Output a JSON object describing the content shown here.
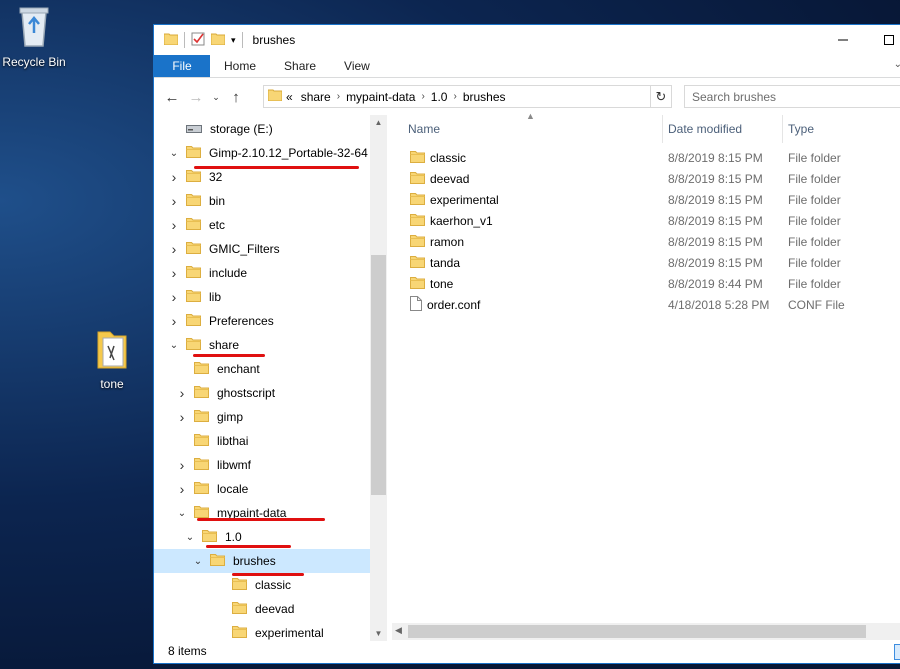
{
  "desktop": {
    "icons": [
      {
        "label": "Recycle Bin",
        "icon": "recycle-bin-icon"
      },
      {
        "label": "tone",
        "icon": "folder-icon"
      }
    ]
  },
  "window": {
    "title": "brushes",
    "ribbon_tabs": [
      "File",
      "Home",
      "Share",
      "View"
    ],
    "breadcrumb": [
      "share",
      "mypaint-data",
      "1.0",
      "brushes"
    ],
    "breadcrumb_overflow": "«",
    "search_placeholder": "Search brushes",
    "status": "8 items"
  },
  "nav_tree": [
    {
      "label": "storage (E:)",
      "level": 0,
      "toggle": "",
      "icon": "drive-icon"
    },
    {
      "label": "Gimp-2.10.12_Portable-32-64",
      "level": 0,
      "toggle": "expanded",
      "icon": "folder-icon"
    },
    {
      "label": "32",
      "level": 1,
      "toggle": "collapsed",
      "icon": "folder-icon"
    },
    {
      "label": "bin",
      "level": 1,
      "toggle": "collapsed",
      "icon": "folder-icon"
    },
    {
      "label": "etc",
      "level": 1,
      "toggle": "collapsed",
      "icon": "folder-icon"
    },
    {
      "label": "GMIC_Filters",
      "level": 1,
      "toggle": "collapsed",
      "icon": "folder-icon"
    },
    {
      "label": "include",
      "level": 1,
      "toggle": "collapsed",
      "icon": "folder-icon"
    },
    {
      "label": "lib",
      "level": 1,
      "toggle": "collapsed",
      "icon": "folder-icon"
    },
    {
      "label": "Preferences",
      "level": 1,
      "toggle": "collapsed",
      "icon": "folder-icon"
    },
    {
      "label": "share",
      "level": 1,
      "toggle": "expanded",
      "icon": "folder-icon"
    },
    {
      "label": "enchant",
      "level": 2,
      "toggle": "",
      "icon": "folder-icon"
    },
    {
      "label": "ghostscript",
      "level": 2,
      "toggle": "collapsed",
      "icon": "folder-icon"
    },
    {
      "label": "gimp",
      "level": 2,
      "toggle": "collapsed",
      "icon": "folder-icon"
    },
    {
      "label": "libthai",
      "level": 2,
      "toggle": "",
      "icon": "folder-icon"
    },
    {
      "label": "libwmf",
      "level": 2,
      "toggle": "collapsed",
      "icon": "folder-icon"
    },
    {
      "label": "locale",
      "level": 2,
      "toggle": "collapsed",
      "icon": "folder-icon"
    },
    {
      "label": "mypaint-data",
      "level": 2,
      "toggle": "expanded",
      "icon": "folder-icon"
    },
    {
      "label": "1.0",
      "level": 3,
      "toggle": "expanded",
      "icon": "folder-icon"
    },
    {
      "label": "brushes",
      "level": 4,
      "toggle": "expanded",
      "icon": "folder-icon",
      "selected": true
    },
    {
      "label": "classic",
      "level": 5,
      "toggle": "",
      "icon": "folder-icon"
    },
    {
      "label": "deevad",
      "level": 5,
      "toggle": "",
      "icon": "folder-icon"
    },
    {
      "label": "experimental",
      "level": 5,
      "toggle": "",
      "icon": "folder-icon"
    }
  ],
  "columns": [
    "Name",
    "Date modified",
    "Type"
  ],
  "files": [
    {
      "name": "classic",
      "date": "8/8/2019 8:15 PM",
      "type": "File folder",
      "icon": "folder-icon"
    },
    {
      "name": "deevad",
      "date": "8/8/2019 8:15 PM",
      "type": "File folder",
      "icon": "folder-icon"
    },
    {
      "name": "experimental",
      "date": "8/8/2019 8:15 PM",
      "type": "File folder",
      "icon": "folder-icon"
    },
    {
      "name": "kaerhon_v1",
      "date": "8/8/2019 8:15 PM",
      "type": "File folder",
      "icon": "folder-icon"
    },
    {
      "name": "ramon",
      "date": "8/8/2019 8:15 PM",
      "type": "File folder",
      "icon": "folder-icon"
    },
    {
      "name": "tanda",
      "date": "8/8/2019 8:15 PM",
      "type": "File folder",
      "icon": "folder-icon"
    },
    {
      "name": "tone",
      "date": "8/8/2019 8:44 PM",
      "type": "File folder",
      "icon": "folder-icon"
    },
    {
      "name": "order.conf",
      "date": "4/18/2018 5:28 PM",
      "type": "CONF File",
      "icon": "file-icon"
    }
  ],
  "colors": {
    "accent": "#1a73c9",
    "selection": "#cce8ff",
    "annotation": "#e01010",
    "folder": "#f8d675"
  }
}
